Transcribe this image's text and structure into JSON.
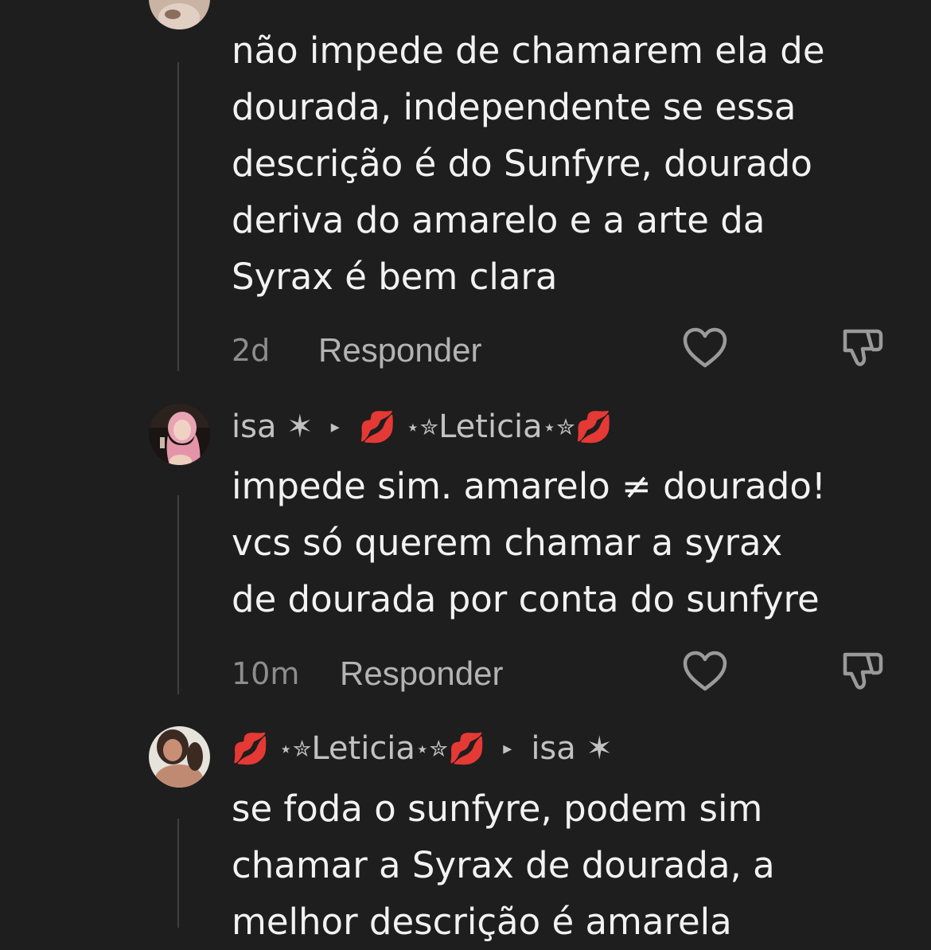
{
  "comments": [
    {
      "text_lines": [
        "não impede de chamarem ela de",
        "dourada, independente se essa",
        "descrição é do Sunfyre, dourado",
        "deriva do amarelo e a arte da",
        "Syrax é bem clara"
      ],
      "time": "2d",
      "reply_label": "Responder"
    },
    {
      "author": "isa ✶",
      "reply_to": {
        "lips_left": "💋",
        "deco_left": "⋆✮",
        "name": "Leticia",
        "deco_right": "⋆✮",
        "lips_right": "💋"
      },
      "text_lines": [
        "impede sim. amarelo ≠ dourado!",
        "vcs só querem chamar a syrax",
        "de dourada por conta do sunfyre"
      ],
      "time": "10m",
      "reply_label": "Responder"
    },
    {
      "author": {
        "lips_left": "💋",
        "deco_left": "⋆✮",
        "name": "Leticia",
        "deco_right": "⋆✮",
        "lips_right": "💋"
      },
      "reply_to": "isa ✶",
      "text_lines": [
        "se foda o sunfyre, podem sim",
        "chamar a Syrax de dourada, a",
        "melhor descrição é amarela"
      ]
    }
  ],
  "icons": {
    "reply_arrow": "▸",
    "like": "heart-outline-icon",
    "dislike": "thumbs-down-outline-icon"
  },
  "colors": {
    "background": "#1e1e1e",
    "text": "#f2f2f2",
    "muted": "#8e8e8e"
  }
}
